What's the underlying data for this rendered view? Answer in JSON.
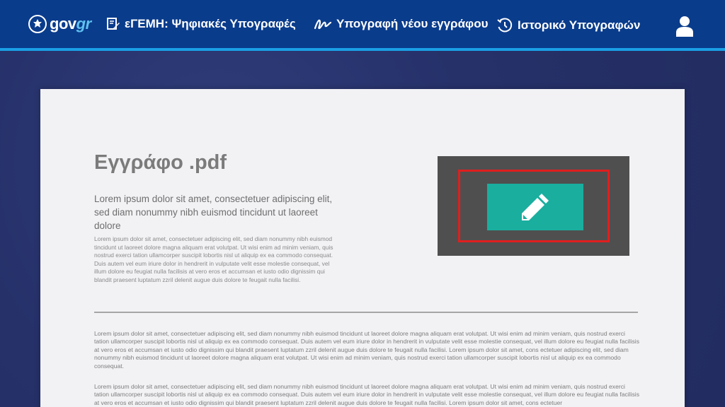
{
  "header": {
    "logo": {
      "text_main": "gov",
      "text_accent": "gr"
    },
    "nav": [
      {
        "label": "εΓΕΜΗ: Ψηφιακές Υπογραφές",
        "icon": "document-sign-icon"
      },
      {
        "label": "Υπογραφή νέου εγγράφου",
        "icon": "signature-icon"
      },
      {
        "label": "Ιστορικό Υπογραφών",
        "icon": "history-clock-icon"
      }
    ],
    "user_icon": "user-icon"
  },
  "document": {
    "title": "Εγγράφο .pdf",
    "subtitle": "Lorem ipsum dolor sit amet, consectetuer adipiscing elit, sed diam nonummy nibh euismod tincidunt ut laoreet dolore",
    "paragraph_small": "Lorem ipsum dolor sit amet, consectetuer adipiscing elit, sed diam nonummy nibh euismod tincidunt ut laoreet dolore magna aliquam erat volutpat. Ut wisi enim ad minim veniam, quis nostrud exerci tation ullamcorper suscipit lobortis nisl ut aliquip ex ea commodo consequat. Duis autem vel eum iriure dolor in hendrerit in vulputate velit esse molestie consequat, vel illum dolore eu feugiat nulla facilisis at vero eros et accumsan et iusto odio dignissim qui blandit praesent luptatum zzril delenit augue duis dolore te feugait nulla facilisi.",
    "body_1": "Lorem ipsum dolor sit amet, consectetuer adipiscing elit, sed diam nonummy nibh euismod tincidunt ut laoreet dolore magna aliquam erat volutpat. Ut wisi enim ad minim veniam, quis nostrud exerci tation ullamcorper suscipit lobortis nisl ut aliquip ex ea commodo consequat. Duis autem vel eum iriure dolor in hendrerit in vulputate velit esse molestie consequat, vel illum dolore eu feugiat nulla facilisis at vero eros et accumsan et iusto odio dignissim qui blandit praesent luptatum zzril delenit augue duis dolore te feugait nulla facilisi. Lorem ipsum dolor sit amet, cons ectetuer adipiscing elit, sed diam nonummy nibh euismod tincidunt ut laoreet dolore magna aliquam erat volutpat. Ut wisi enim ad minim veniam, quis nostrud exerci tation ullamcorper suscipit lobortis nisl ut aliquip ex ea commodo consequat.",
    "body_2": "Lorem ipsum dolor sit amet, consectetuer adipiscing elit, sed diam nonummy nibh euismod tincidunt ut laoreet dolore magna aliquam erat volutpat. Ut wisi enim ad minim veniam, quis nostrud exerci tation ullamcorper suscipit lobortis nisl ut aliquip ex ea commodo consequat. Duis autem vel eum iriure dolor in hendrerit in vulputate velit esse molestie consequat, vel illum dolore eu feugiat nulla facilisis at vero eros et accumsan et iusto odio dignissim qui blandit praesent luptatum zzril delenit augue duis dolore te feugait nulla facilisi. Lorem ipsum dolor sit amet, cons ectetuer",
    "sign_button_icon": "pencil-icon"
  },
  "colors": {
    "header_bg": "#0a3c8c",
    "header_accent_line": "#1aa0e6",
    "sign_button": "#1aae9f",
    "highlight_frame": "#e01e1e",
    "sign_panel": "#4f4f4f"
  }
}
